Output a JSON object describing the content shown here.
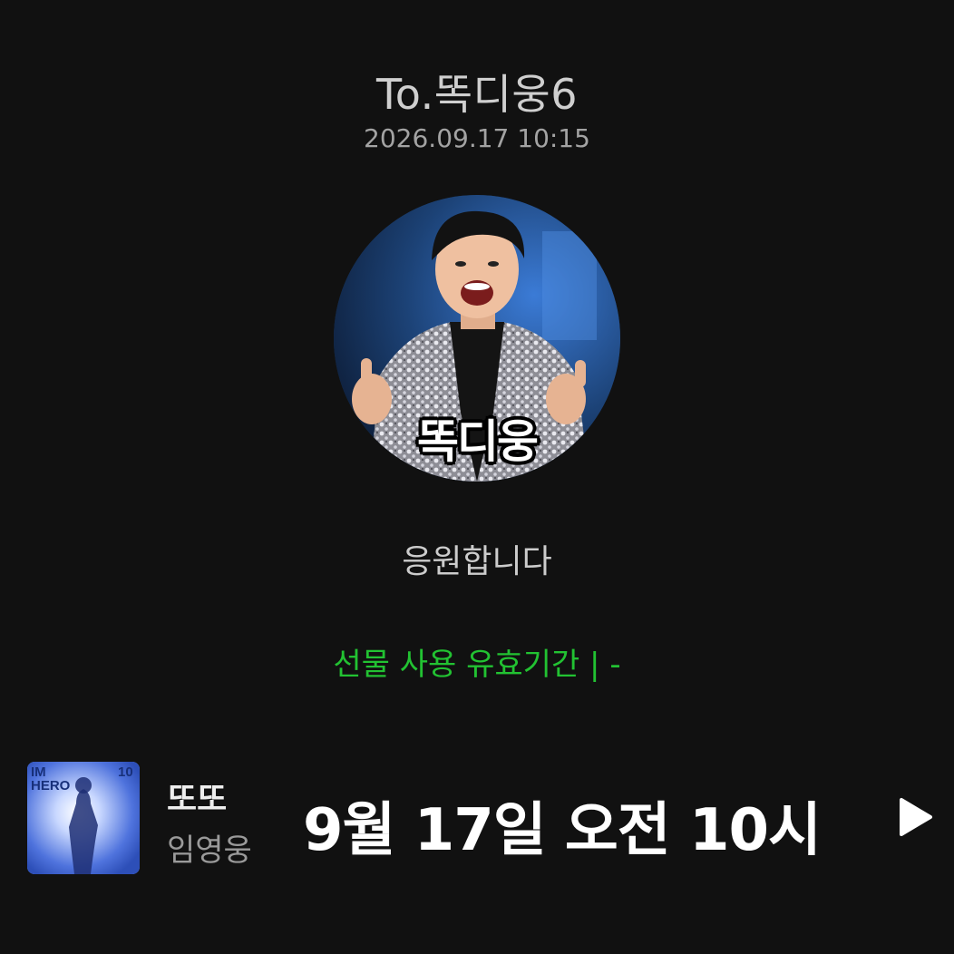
{
  "header": {
    "recipient": "To.똑디웅6",
    "timestamp": "2026.09.17 10:15"
  },
  "avatar": {
    "caption": "똑디웅"
  },
  "message": "응원합니다",
  "gift": {
    "validity": "선물 사용 유효기간 |   -"
  },
  "music": {
    "album_text_top": "IM",
    "album_text_hero": "HERO",
    "album_text_num": "10",
    "title": "또또",
    "artist": "임영웅",
    "schedule": "9월 17일 오전 10시",
    "play_icon": "play-icon"
  },
  "colors": {
    "background": "#111111",
    "accent_green": "#22c232"
  }
}
